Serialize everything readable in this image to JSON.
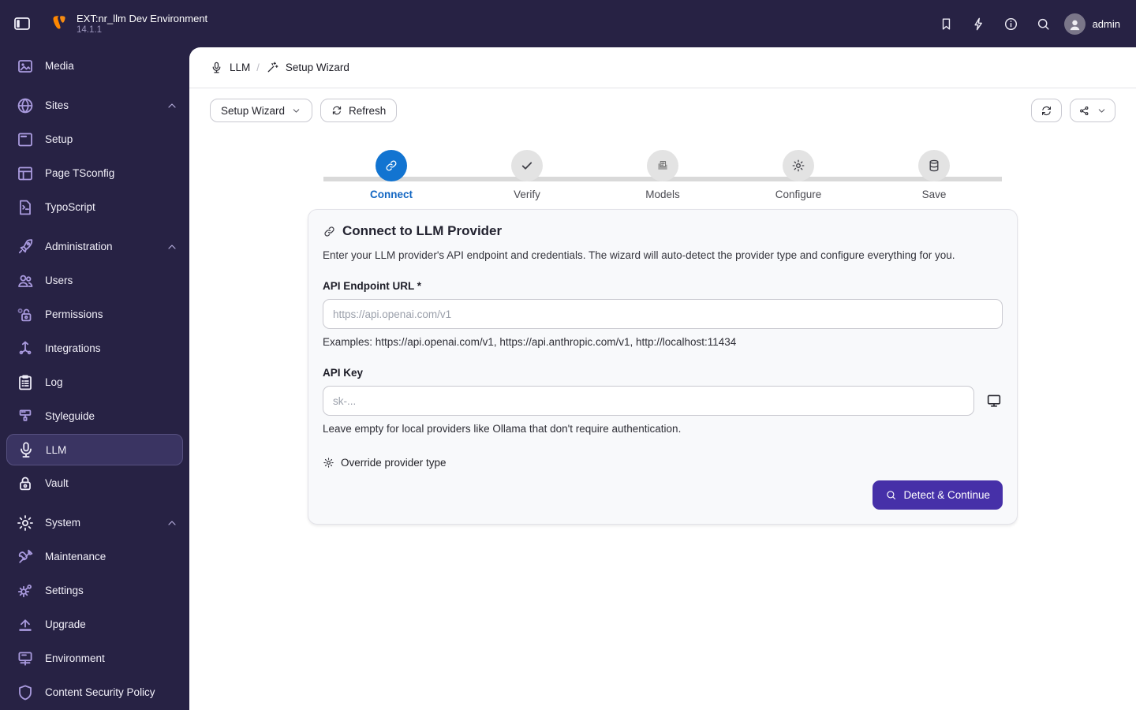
{
  "topbar": {
    "title": "EXT:nr_llm Dev Environment",
    "version": "14.1.1",
    "username": "admin",
    "right_icons": [
      {
        "icon": "bookmark"
      },
      {
        "icon": "zap"
      },
      {
        "icon": "info"
      },
      {
        "icon": "search"
      }
    ]
  },
  "sidebar": {
    "items": [
      {
        "label": "Media",
        "icon": "media"
      },
      {
        "label": "Sites",
        "icon": "globe",
        "chevron": true,
        "gap": true
      },
      {
        "label": "Setup",
        "icon": "setup"
      },
      {
        "label": "Page TSconfig",
        "icon": "pagets"
      },
      {
        "label": "TypoScript",
        "icon": "typoscript"
      },
      {
        "label": "Administration",
        "icon": "rocket",
        "chevron": true,
        "gap": true
      },
      {
        "label": "Users",
        "icon": "users"
      },
      {
        "label": "Permissions",
        "icon": "permissions"
      },
      {
        "label": "Integrations",
        "icon": "integrations"
      },
      {
        "label": "Log",
        "icon": "log",
        "lite": true
      },
      {
        "label": "Styleguide",
        "icon": "styleguide"
      },
      {
        "label": "LLM",
        "icon": "mic",
        "selected": true,
        "lite": true
      },
      {
        "label": "Vault",
        "icon": "vault",
        "lite": true
      },
      {
        "label": "System",
        "icon": "gear",
        "chevron": true,
        "gap": true,
        "lite": true
      },
      {
        "label": "Maintenance",
        "icon": "wrench"
      },
      {
        "label": "Settings",
        "icon": "settings"
      },
      {
        "label": "Upgrade",
        "icon": "upgrade"
      },
      {
        "label": "Environment",
        "icon": "environment"
      },
      {
        "label": "Content Security Policy",
        "icon": "shield"
      }
    ]
  },
  "breadcrumb": {
    "separator": "/",
    "items": [
      {
        "label": "LLM",
        "icon": "mic"
      },
      {
        "label": "Setup Wizard",
        "icon": "wand"
      }
    ]
  },
  "toolbar": {
    "module_select_label": "Setup Wizard",
    "refresh_label": "Refresh"
  },
  "wizard": {
    "steps": [
      {
        "label": "Connect",
        "icon": "link",
        "active": true
      },
      {
        "label": "Verify",
        "icon": "check"
      },
      {
        "label": "Models",
        "icon": "models"
      },
      {
        "label": "Configure",
        "icon": "gear"
      },
      {
        "label": "Save",
        "icon": "database"
      }
    ]
  },
  "card": {
    "title": "Connect to LLM Provider",
    "description": "Enter your LLM provider's API endpoint and credentials. The wizard will auto-detect the provider type and configure everything for you.",
    "endpoint": {
      "label": "API Endpoint URL *",
      "placeholder": "https://api.openai.com/v1",
      "help": "Examples: https://api.openai.com/v1, https://api.anthropic.com/v1, http://localhost:11434"
    },
    "api_key": {
      "label": "API Key",
      "placeholder": "sk-...",
      "help": "Leave empty for local providers like Ollama that don't require authentication."
    },
    "override_label": "Override provider type",
    "submit_label": "Detect & Continue"
  },
  "colors": {
    "brand_orange": "#ff8700",
    "active_step_blue": "#1274d1",
    "primary_button_purple": "#4630a8",
    "topbar_bg": "#272244",
    "selected_item_bg": "#3a3462"
  }
}
